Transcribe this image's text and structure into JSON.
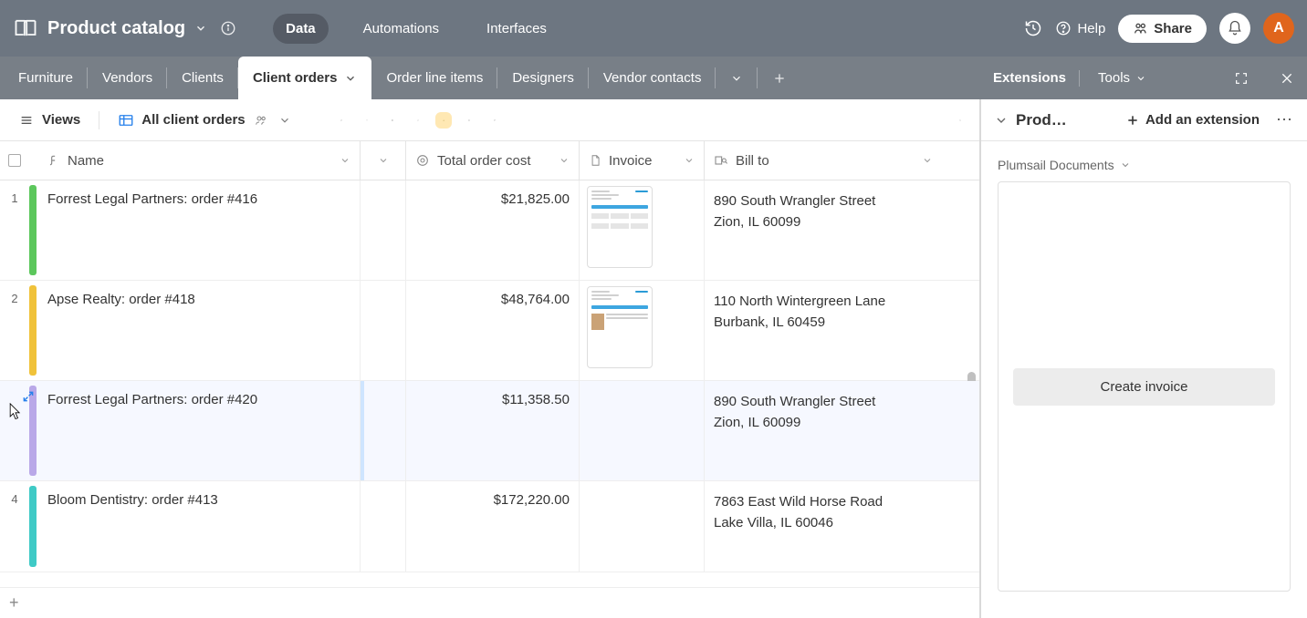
{
  "header": {
    "title": "Product catalog",
    "segments": [
      "Data",
      "Automations",
      "Interfaces"
    ],
    "active_segment": 0,
    "help_label": "Help",
    "share_label": "Share",
    "avatar_letter": "A"
  },
  "tabs": {
    "items": [
      "Furniture",
      "Vendors",
      "Clients",
      "Client orders",
      "Order line items",
      "Designers",
      "Vendor contacts"
    ],
    "active_index": 3
  },
  "toolbar": {
    "views_label": "Views",
    "view_name": "All client orders"
  },
  "columns": {
    "name": "Name",
    "total": "Total order cost",
    "invoice": "Invoice",
    "bill": "Bill to"
  },
  "rows": [
    {
      "num": "1",
      "color": "c-green",
      "name": "Forrest Legal Partners: order #416",
      "total": "$21,825.00",
      "has_invoice": true,
      "bill1": "890 South Wrangler Street",
      "bill2": "Zion, IL 60099"
    },
    {
      "num": "2",
      "color": "c-yellow",
      "name": "Apse Realty: order #418",
      "total": "$48,764.00",
      "has_invoice": true,
      "bill1": "110 North Wintergreen Lane",
      "bill2": "Burbank, IL 60459"
    },
    {
      "num": "",
      "color": "c-purple",
      "name": "Forrest Legal Partners: order #420",
      "total": "$11,358.50",
      "has_invoice": false,
      "bill1": "890 South Wrangler Street",
      "bill2": "Zion, IL 60099",
      "hovered": true
    },
    {
      "num": "4",
      "color": "c-teal",
      "name": "Bloom Dentistry: order #413",
      "total": "$172,220.00",
      "has_invoice": false,
      "bill1": "7863 East Wild Horse Road",
      "bill2": "Lake Villa, IL 60046"
    }
  ],
  "ext": {
    "tabs": [
      "Extensions",
      "Tools"
    ],
    "active": 0,
    "title_trunc": "Prod…",
    "add_label": "Add an extension",
    "plumsail": "Plumsail Documents",
    "create_btn": "Create invoice"
  }
}
